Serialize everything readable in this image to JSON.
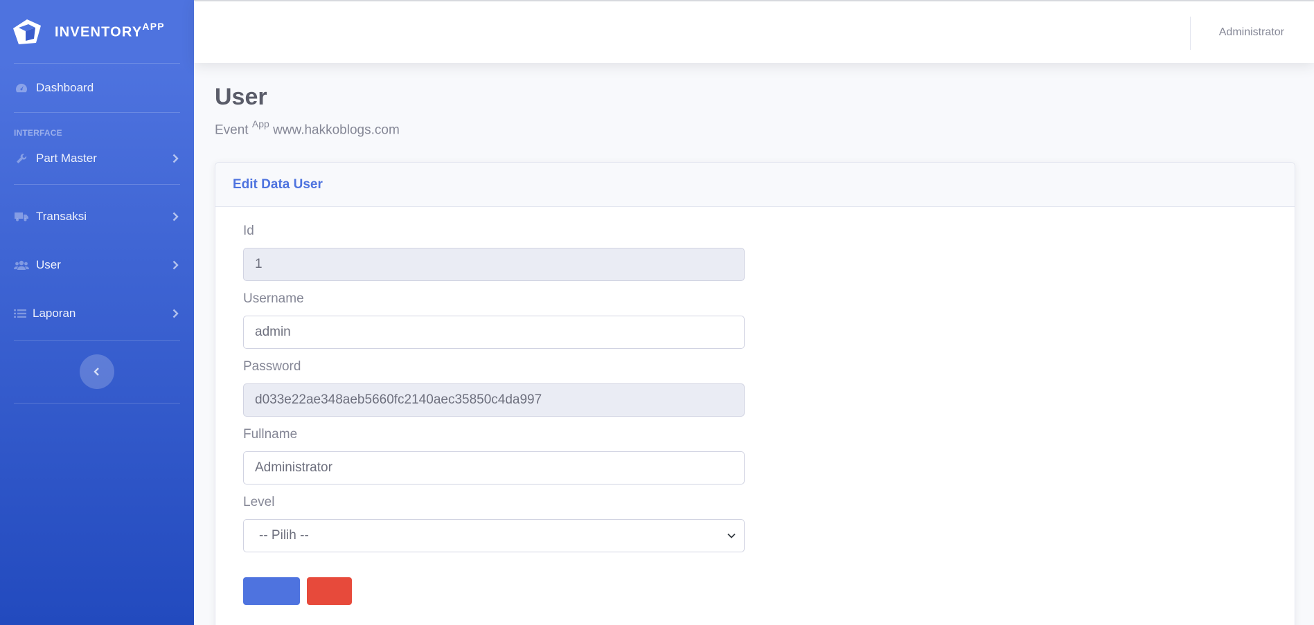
{
  "brand": {
    "name": "INVENTORY",
    "sup": "APP"
  },
  "sidebar": {
    "dashboard": "Dashboard",
    "heading": "INTERFACE",
    "items": [
      {
        "label": "Part Master",
        "icon": "wrench-icon"
      },
      {
        "label": "Transaksi",
        "icon": "truck-icon"
      },
      {
        "label": "User",
        "icon": "users-icon"
      },
      {
        "label": "Laporan",
        "icon": "list-icon"
      }
    ]
  },
  "topbar": {
    "user": "Administrator"
  },
  "page": {
    "title": "User",
    "subtitle_prefix": "Event",
    "subtitle_sup": "App",
    "subtitle_suffix": "www.hakkoblogs.com"
  },
  "card": {
    "title": "Edit Data User"
  },
  "form": {
    "id_label": "Id",
    "id_value": "1",
    "username_label": "Username",
    "username_value": "admin",
    "password_label": "Password",
    "password_value": "d033e22ae348aeb5660fc2140aec35850c4da997",
    "fullname_label": "Fullname",
    "fullname_value": "Administrator",
    "level_label": "Level",
    "level_value": "-- Pilih --"
  },
  "colors": {
    "primary": "#4e73df",
    "danger": "#e74a3b",
    "sidebar_end": "#224abe"
  }
}
